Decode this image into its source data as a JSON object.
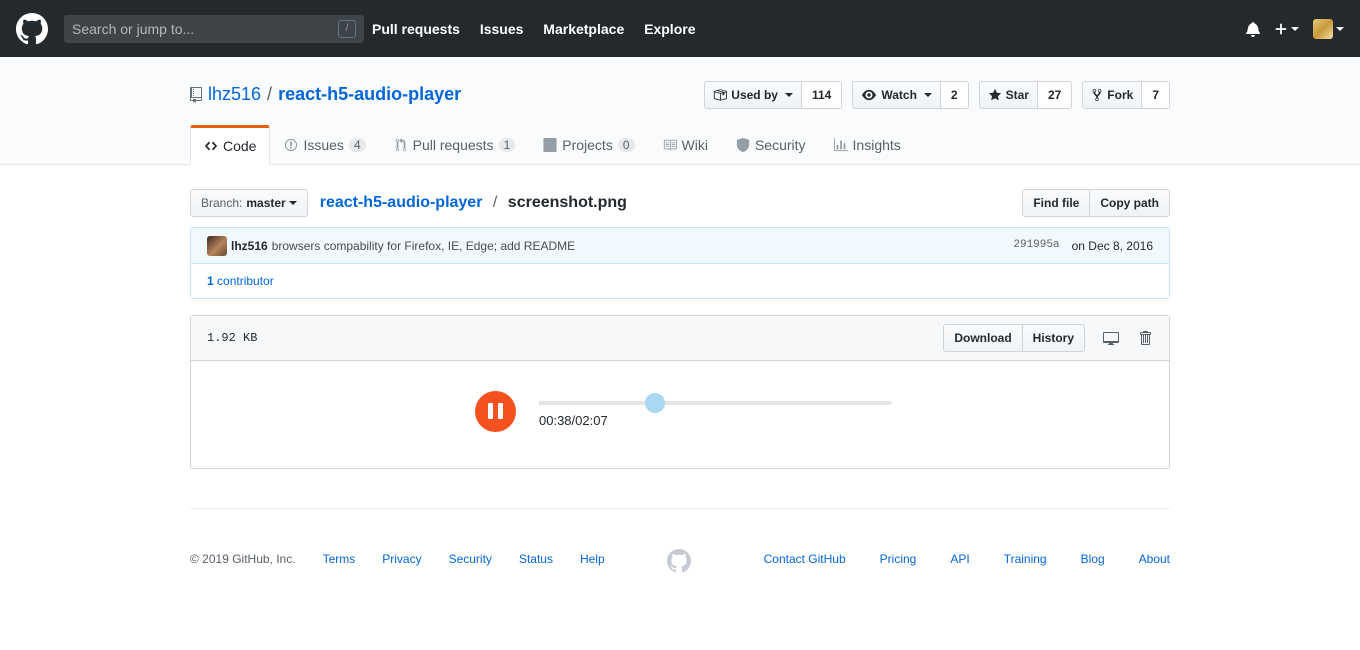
{
  "topbar": {
    "search_placeholder": "Search or jump to...",
    "slash_key": "/",
    "nav": [
      "Pull requests",
      "Issues",
      "Marketplace",
      "Explore"
    ]
  },
  "repo": {
    "owner": "lhz516",
    "name": "react-h5-audio-player",
    "used_by_label": "Used by",
    "used_by_count": "114",
    "watch_label": "Watch",
    "watch_count": "2",
    "star_label": "Star",
    "star_count": "27",
    "fork_label": "Fork",
    "fork_count": "7"
  },
  "tabs": [
    {
      "label": "Code",
      "count": null
    },
    {
      "label": "Issues",
      "count": "4"
    },
    {
      "label": "Pull requests",
      "count": "1"
    },
    {
      "label": "Projects",
      "count": "0"
    },
    {
      "label": "Wiki",
      "count": null
    },
    {
      "label": "Security",
      "count": null
    },
    {
      "label": "Insights",
      "count": null
    }
  ],
  "filenav": {
    "branch_label": "Branch:",
    "branch_value": "master",
    "repo_crumb": "react-h5-audio-player",
    "sep": "/",
    "file_crumb": "screenshot.png",
    "find_file": "Find file",
    "copy_path": "Copy path"
  },
  "commit": {
    "author": "lhz516",
    "message": "browsers compability for Firefox, IE, Edge; add README",
    "sha": "291995a",
    "date": "on Dec 8, 2016",
    "contributors_count": "1",
    "contributors_label": "contributor"
  },
  "file": {
    "size": "1.92 KB",
    "download": "Download",
    "history": "History"
  },
  "player": {
    "time": "00:38/02:07",
    "progress_fraction": 0.33,
    "colors": {
      "button": "#f4511e",
      "knob": "#a9d8f2",
      "track": "#e5e5e5"
    }
  },
  "footer": {
    "copyright": "© 2019 GitHub, Inc.",
    "left_links": [
      "Terms",
      "Privacy",
      "Security",
      "Status",
      "Help"
    ],
    "right_links": [
      "Contact GitHub",
      "Pricing",
      "API",
      "Training",
      "Blog",
      "About"
    ]
  }
}
